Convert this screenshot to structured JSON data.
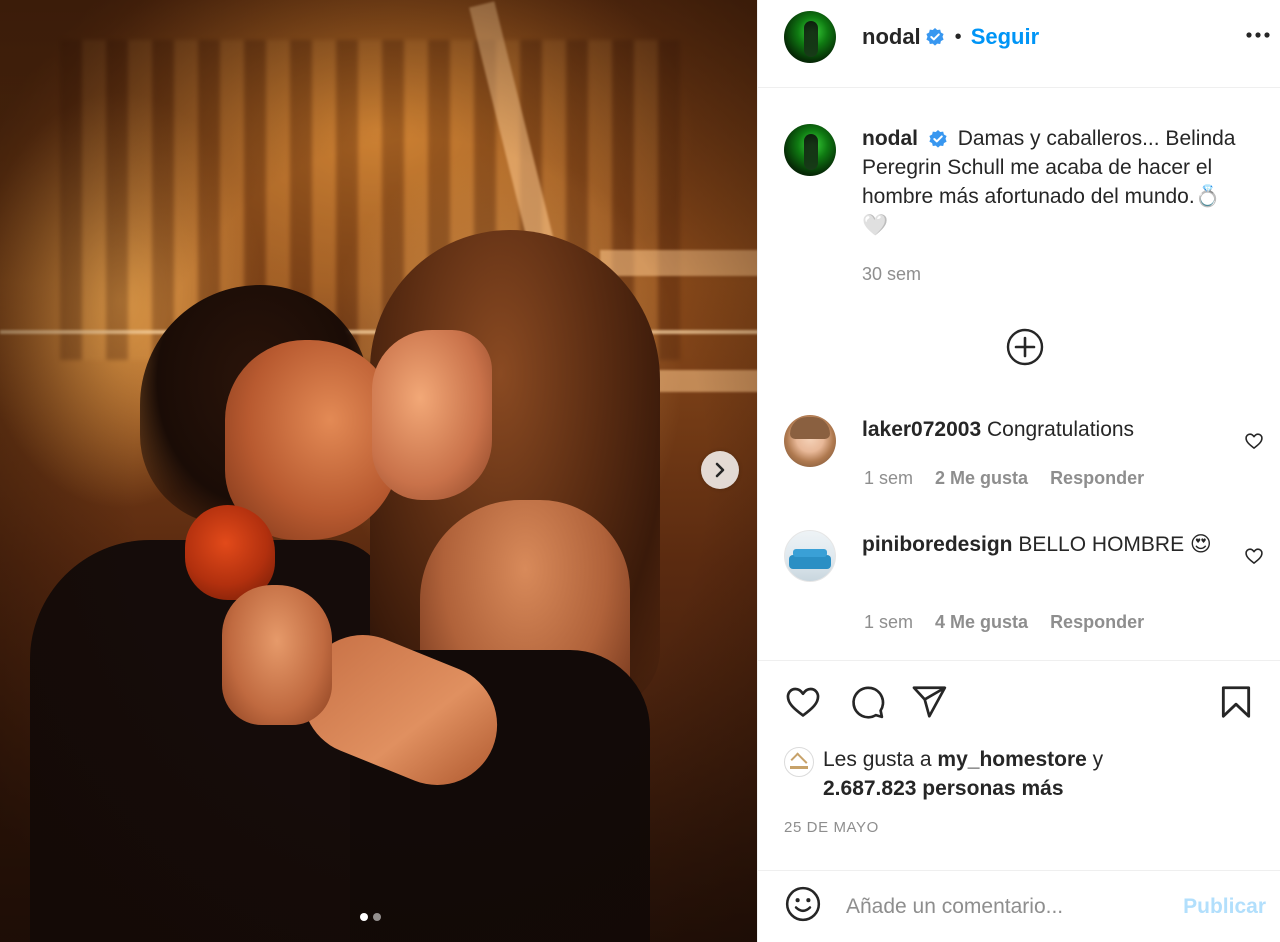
{
  "photo": {
    "alt": "",
    "carousel_dots": [
      true,
      false
    ]
  },
  "header": {
    "username": "nodal",
    "separator": "•",
    "follow_label": "Seguir"
  },
  "caption": {
    "username": "nodal",
    "text": "Damas y caballeros... Belinda Peregrin Schull me acaba de hacer el hombre más afortunado del mundo.💍🤍",
    "time": "30 sem"
  },
  "comments": [
    {
      "username": "laker072003",
      "text": "Congratulations",
      "time": "1 sem",
      "likes": "2 Me gusta",
      "reply": "Responder"
    },
    {
      "username": "piniboredesign",
      "text": "BELLO HOMBRE 😍",
      "time": "1 sem",
      "likes": "4 Me gusta",
      "reply": "Responder"
    }
  ],
  "likes": {
    "prefix": "Les gusta a ",
    "first_user": "my_homestore",
    "middle": " y ",
    "others": "2.687.823 personas más"
  },
  "date": "25 DE MAYO",
  "composer": {
    "placeholder": "Añade un comentario...",
    "publish_label": "Publicar"
  },
  "colors": {
    "accent": "#0095f6",
    "publish_disabled": "#b2dffc",
    "secondary_text": "#8e8e8e",
    "verified": "#3897f0"
  }
}
